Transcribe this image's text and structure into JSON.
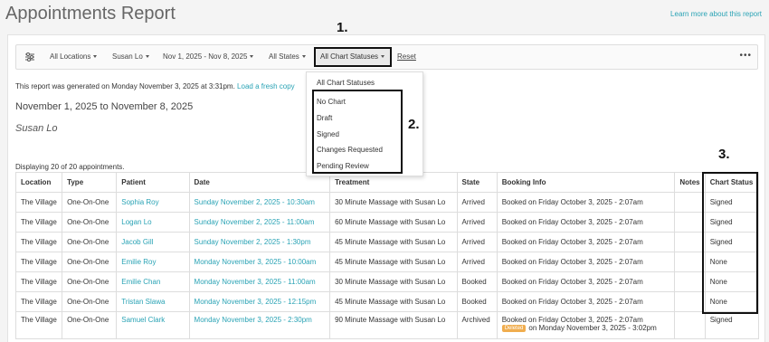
{
  "page": {
    "title": "Appointments Report",
    "learn_more": "Learn more about this report"
  },
  "filters": {
    "locations": "All Locations",
    "staff": "Susan Lo",
    "date_range": "Nov 1, 2025 - Nov 8, 2025",
    "states": "All States",
    "chart_statuses": "All Chart Statuses",
    "reset": "Reset",
    "more": "•••"
  },
  "report": {
    "generated_text": "This report was generated on Monday November 3, 2025 at 3:31pm.",
    "fresh_copy": "Load a fresh copy",
    "range": "November 1, 2025 to November 8, 2025",
    "staff_name": "Susan Lo",
    "displaying": "Displaying 20 of 20 appointments."
  },
  "dropdown": {
    "items": [
      "All Chart Statuses",
      "No Chart",
      "Draft",
      "Signed",
      "Changes Requested",
      "Pending Review"
    ]
  },
  "callouts": [
    "1.",
    "2.",
    "3."
  ],
  "table": {
    "headers": [
      "Location",
      "Type",
      "Patient",
      "Date",
      "Treatment",
      "State",
      "Booking Info",
      "Notes",
      "Chart Status"
    ],
    "rows": [
      {
        "location": "The Village",
        "type": "One-On-One",
        "patient": "Sophia Roy",
        "date": "Sunday November 2, 2025 - 10:30am",
        "treatment": "30 Minute Massage with Susan Lo",
        "state": "Arrived",
        "booking": "Booked on Friday October 3, 2025 - 2:07am",
        "notes": "",
        "chart_status": "Signed"
      },
      {
        "location": "The Village",
        "type": "One-On-One",
        "patient": "Logan Lo",
        "date": "Sunday November 2, 2025 - 11:00am",
        "treatment": "60 Minute Massage with Susan Lo",
        "state": "Arrived",
        "booking": "Booked on Friday October 3, 2025 - 2:07am",
        "notes": "",
        "chart_status": "Signed"
      },
      {
        "location": "The Village",
        "type": "One-On-One",
        "patient": "Jacob Gill",
        "date": "Sunday November 2, 2025 - 1:30pm",
        "treatment": "45 Minute Massage with Susan Lo",
        "state": "Arrived",
        "booking": "Booked on Friday October 3, 2025 - 2:07am",
        "notes": "",
        "chart_status": "Signed"
      },
      {
        "location": "The Village",
        "type": "One-On-One",
        "patient": "Emilie Roy",
        "date": "Monday November 3, 2025 - 10:00am",
        "treatment": "45 Minute Massage with Susan Lo",
        "state": "Arrived",
        "booking": "Booked on Friday October 3, 2025 - 2:07am",
        "notes": "",
        "chart_status": "None"
      },
      {
        "location": "The Village",
        "type": "One-On-One",
        "patient": "Emilie Chan",
        "date": "Monday November 3, 2025 - 11:00am",
        "treatment": "30 Minute Massage with Susan Lo",
        "state": "Booked",
        "booking": "Booked on Friday October 3, 2025 - 2:07am",
        "notes": "",
        "chart_status": "None"
      },
      {
        "location": "The Village",
        "type": "One-On-One",
        "patient": "Tristan Slawa",
        "date": "Monday November 3, 2025 - 12:15pm",
        "treatment": "45 Minute Massage with Susan Lo",
        "state": "Booked",
        "booking": "Booked on Friday October 3, 2025 - 2:07am",
        "notes": "",
        "chart_status": "None"
      },
      {
        "location": "The Village",
        "type": "One-On-One",
        "patient": "Samuel Clark",
        "date": "Monday November 3, 2025 - 2:30pm",
        "treatment": "90 Minute Massage with Susan Lo",
        "state": "Archived",
        "booking": "Booked on Friday October 3, 2025 - 2:07am",
        "deleted_badge": "Deleted",
        "deleted_text": "on Monday November 3, 2025 - 3:02pm",
        "notes": "",
        "chart_status": "Signed"
      }
    ]
  }
}
